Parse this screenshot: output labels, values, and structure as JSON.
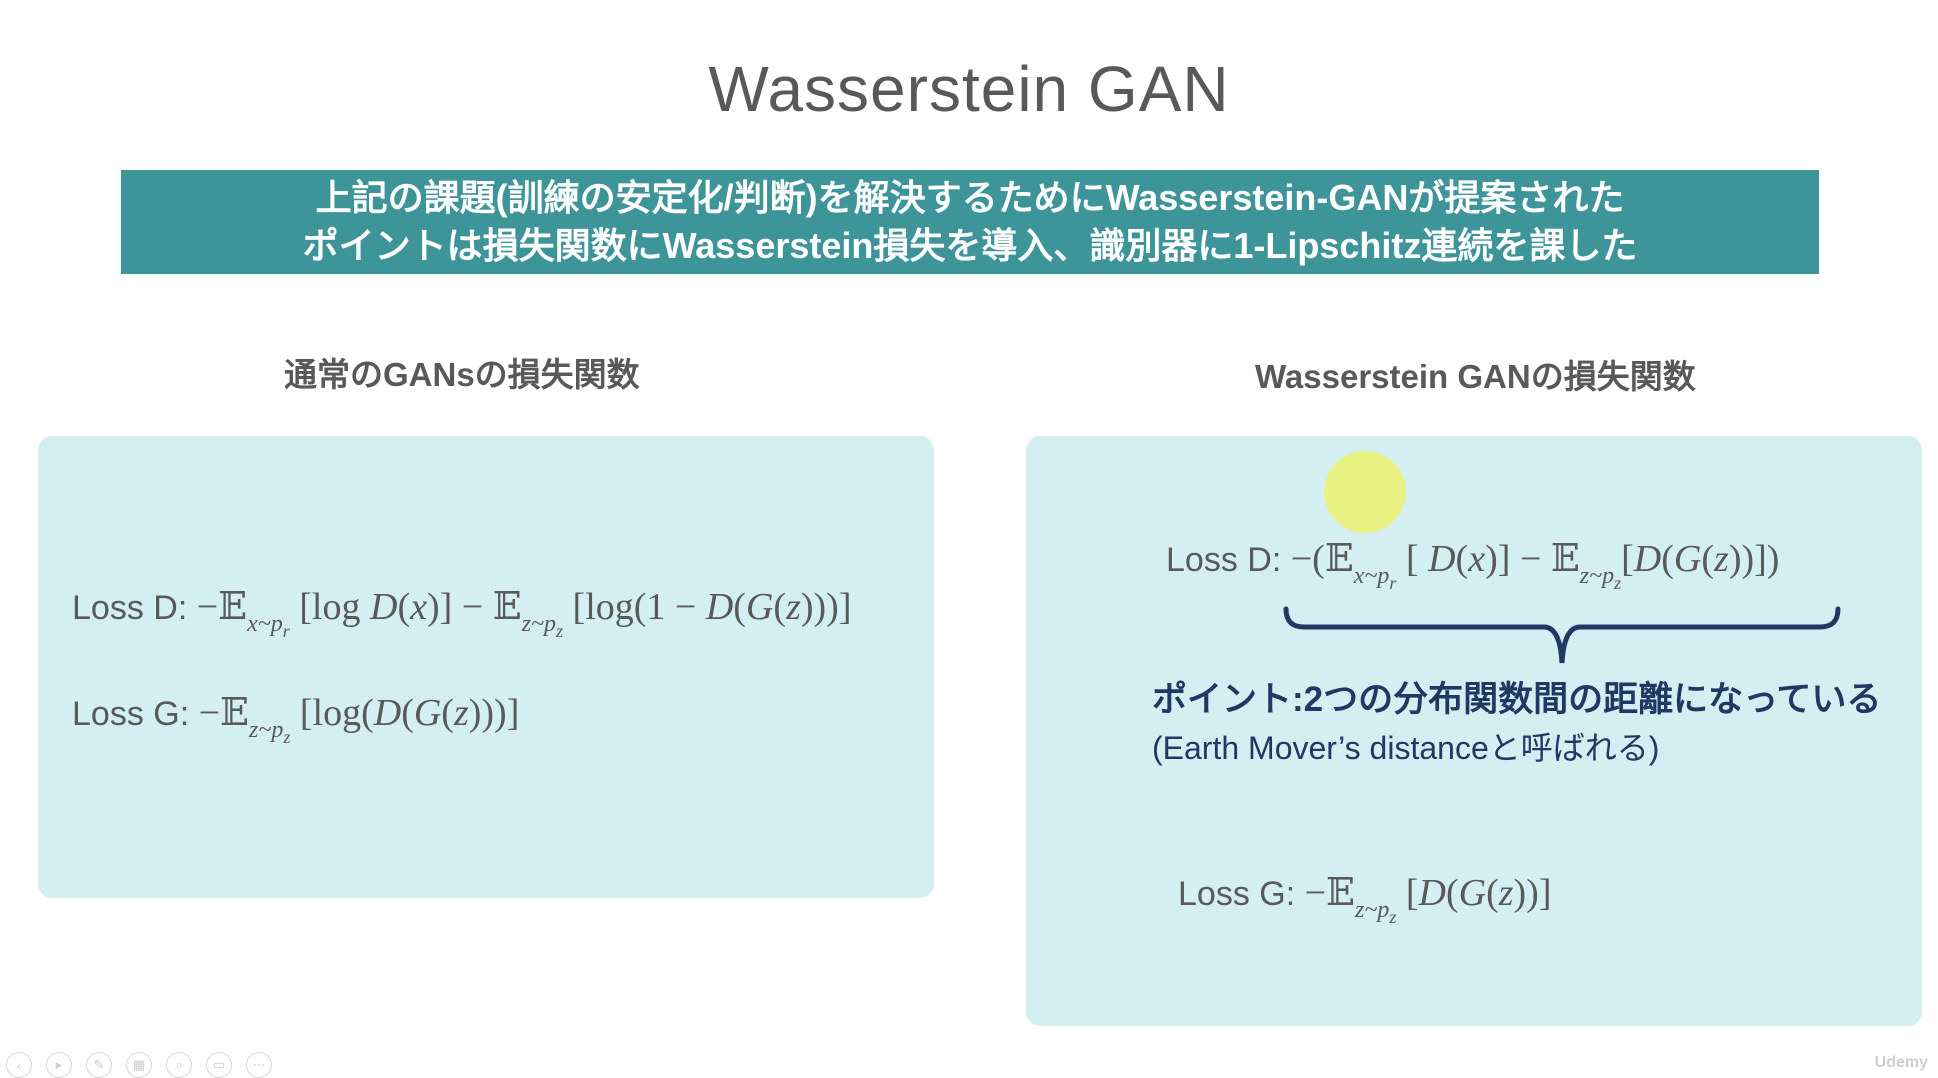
{
  "slide": {
    "title": "Wasserstein GAN",
    "banner": {
      "line1": "上記の課題(訓練の安定化/判断)を解決するためにWasserstein-GANが提案された",
      "line2": "ポイントは損失関数にWasserstein損失を導入、識別器に1-Lipschitz連続を課した"
    },
    "left": {
      "heading": "通常のGANsの損失関数",
      "loss_d_label": "Loss D: ",
      "loss_g_label": "Loss G: "
    },
    "right": {
      "heading": "Wasserstein GANの損失関数",
      "loss_d_label": "Loss D: ",
      "loss_g_label": "Loss G: ",
      "note_line1": "ポイント:2つの分布関数間の距離になっている",
      "note_line2": "(Earth Mover’s distanceと呼ばれる)"
    }
  },
  "colors": {
    "banner_bg": "#3e9599",
    "panel_bg": "#d4eff2",
    "note_text": "#1f3864",
    "pointer_highlight": "#e9f07a"
  },
  "toolbar": {
    "icons": [
      "prev-icon",
      "play-icon",
      "pen-icon",
      "slides-icon",
      "zoom-icon",
      "subtitles-icon",
      "more-icon"
    ]
  },
  "brand": "Udemy"
}
